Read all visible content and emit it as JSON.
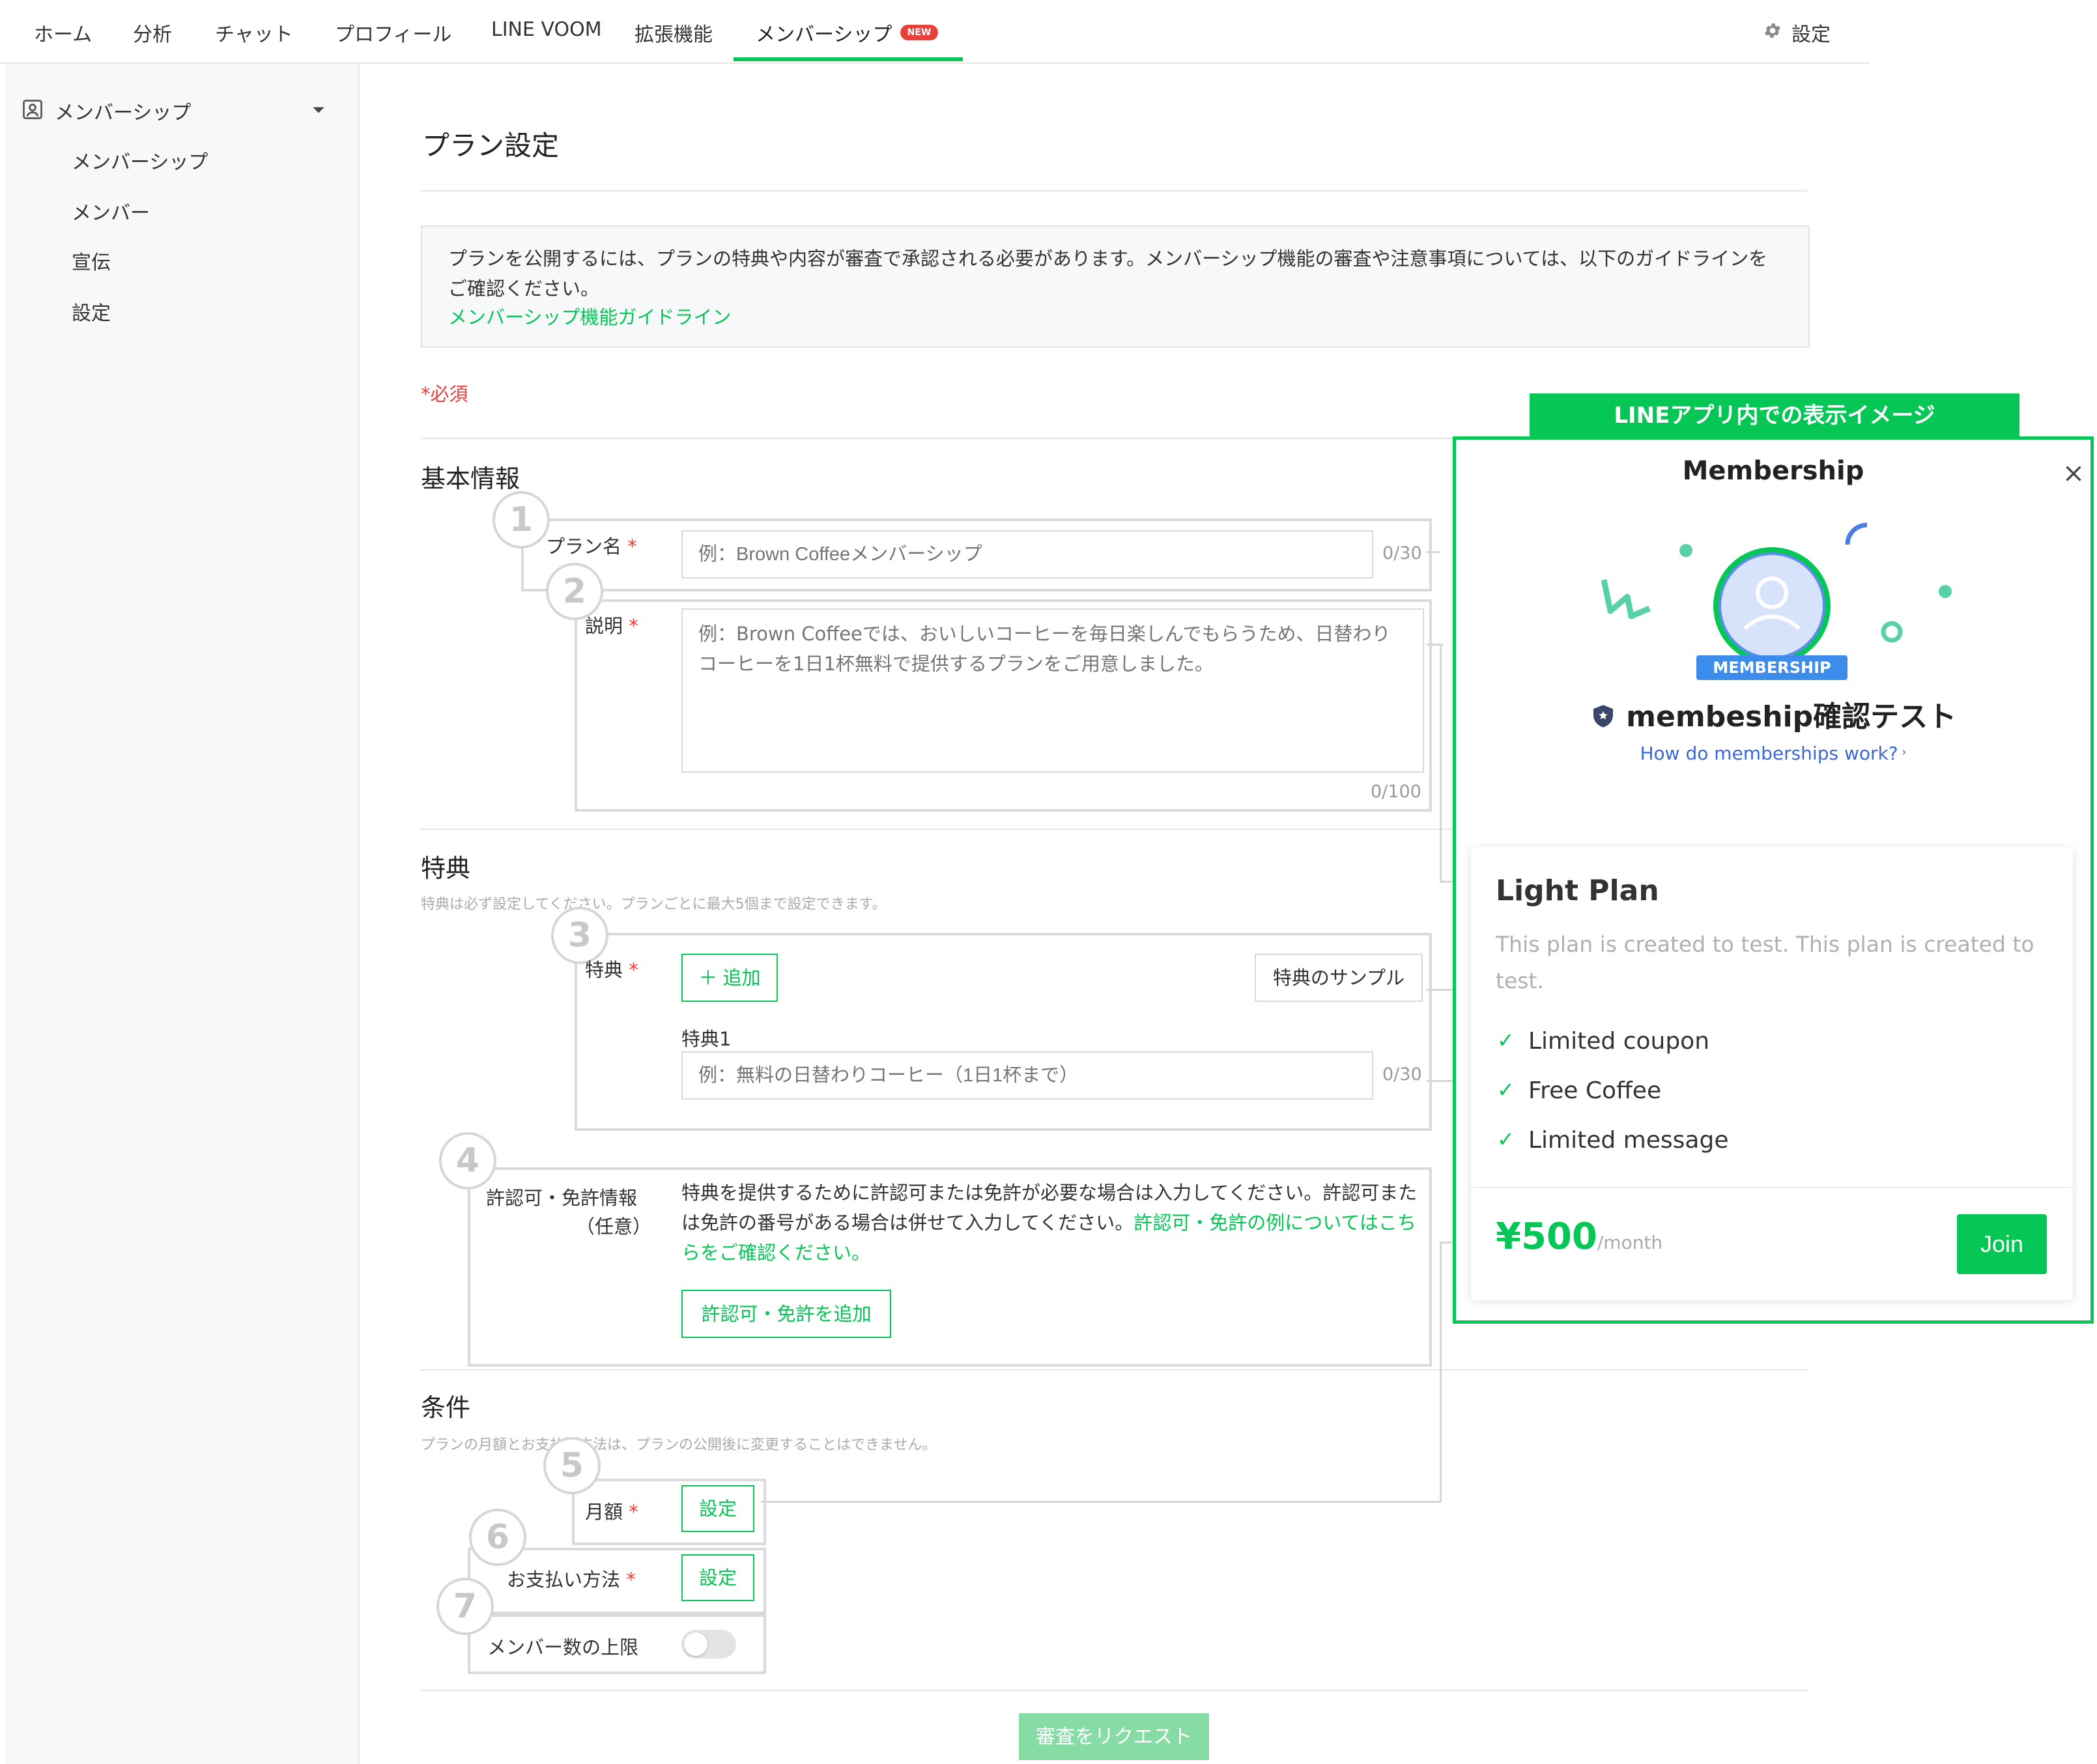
{
  "colors": {
    "brand": "#06c755",
    "required": "#e8413c",
    "muted": "#b0b0b0"
  },
  "topnav": {
    "items": [
      "ホーム",
      "分析",
      "チャット",
      "プロフィール",
      "LINE VOOM",
      "拡張機能",
      "メンバーシップ"
    ],
    "new_badge": "NEW",
    "settings_icon": "gear-icon",
    "settings_label": "設定"
  },
  "sidebar": {
    "section_icon": "user-card-icon",
    "section_label": "メンバーシップ",
    "items": [
      "メンバーシップ",
      "メンバー",
      "宣伝",
      "設定"
    ]
  },
  "page": {
    "title": "プラン設定",
    "notice_text": "プランを公開するには、プランの特典や内容が審査で承認される必要があります。メンバーシップ機能の審査や注意事項については、以下のガイドラインをご確認ください。",
    "notice_link": "メンバーシップ機能ガイドライン",
    "required_note": "*必須"
  },
  "basic": {
    "title": "基本情報",
    "markers": [
      "1",
      "2"
    ],
    "plan_name_label": "プラン名",
    "plan_name_placeholder": "例：Brown Coffeeメンバーシップ",
    "plan_name_counter": "0/30",
    "desc_label": "説明",
    "desc_placeholder": "例：Brown Coffeeでは、おいしいコーヒーを毎日楽しんでもらうため、日替わりコーヒーを1日1杯無料で提供するプランをご用意しました。",
    "desc_counter": "0/100"
  },
  "benefits": {
    "title": "特典",
    "hint": "特典は必ず設定してください。プランごとに最大5個まで設定できます。",
    "marker": "3",
    "label": "特典",
    "add_button": "＋ 追加",
    "sample_button": "特典のサンプル",
    "item_label": "特典1",
    "item_placeholder": "例：無料の日替わりコーヒー（1日1杯まで）",
    "item_counter": "0/30"
  },
  "license": {
    "marker": "4",
    "label_line1": "許認可・免許情報",
    "label_line2": "（任意）",
    "text": "特典を提供するために許認可または免許が必要な場合は入力してください。許認可または免許の番号がある場合は併せて入力してください。",
    "link": "許認可・免許の例についてはこちらをご確認ください。",
    "add_button": "許認可・免許を追加"
  },
  "conditions": {
    "title": "条件",
    "hint": "プランの月額とお支払い方法は、プランの公開後に変更することはできません。",
    "markers": [
      "5",
      "6",
      "7"
    ],
    "monthly_label": "月額",
    "monthly_button": "設定",
    "payment_label": "お支払い方法",
    "payment_button": "設定",
    "limit_label": "メンバー数の上限",
    "limit_enabled": false
  },
  "submit_label": "審査をリクエスト",
  "preview": {
    "banner": "LINEアプリ内での表示イメージ",
    "header": "Membership",
    "close_icon": "close-icon",
    "badge": "MEMBERSHIP",
    "account_name": "membeship確認テスト",
    "how_link": "How do memberships work?",
    "plan_title": "Light Plan",
    "plan_desc": "This plan is created to test. This plan is created to test.",
    "features": [
      "Limited coupon",
      "Free Coffee",
      "Limited message"
    ],
    "price": "¥500",
    "price_unit": "/month",
    "join_label": "Join"
  }
}
